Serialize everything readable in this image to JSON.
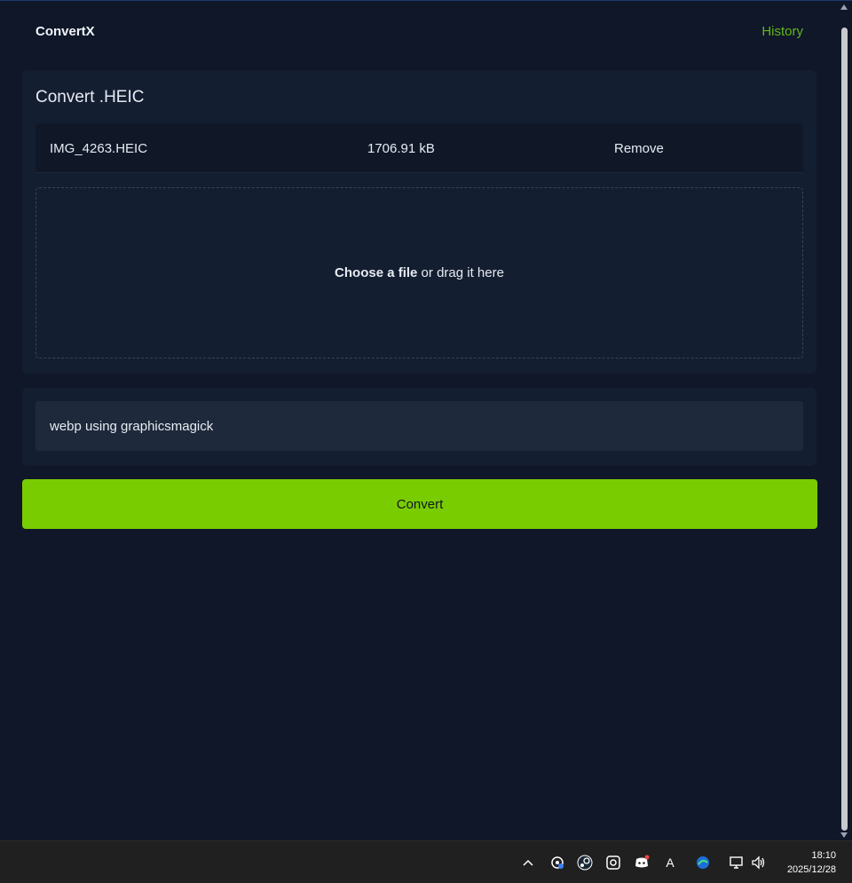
{
  "header": {
    "brand": "ConvertX",
    "history_label": "History"
  },
  "upload": {
    "title": "Convert .HEIC",
    "file": {
      "name": "IMG_4263.HEIC",
      "size": "1706.91 kB",
      "remove_label": "Remove"
    },
    "dropzone": {
      "choose_label": "Choose a file",
      "drag_label": " or drag it here"
    }
  },
  "target": {
    "selected": "webp using graphicsmagick"
  },
  "convert_label": "Convert",
  "colors": {
    "background": "#0f1729",
    "card": "#141e31",
    "accent": "#79cc00",
    "link": "#62b617"
  },
  "taskbar": {
    "icons": [
      "chevron-up-icon",
      "network-gear-icon",
      "steam-icon",
      "capture-icon",
      "discord-icon",
      "ime-icon",
      "edge-icon",
      "display-icon",
      "volume-icon"
    ],
    "ime_label": "A",
    "time": "18:10",
    "date": "2025/12/28"
  }
}
